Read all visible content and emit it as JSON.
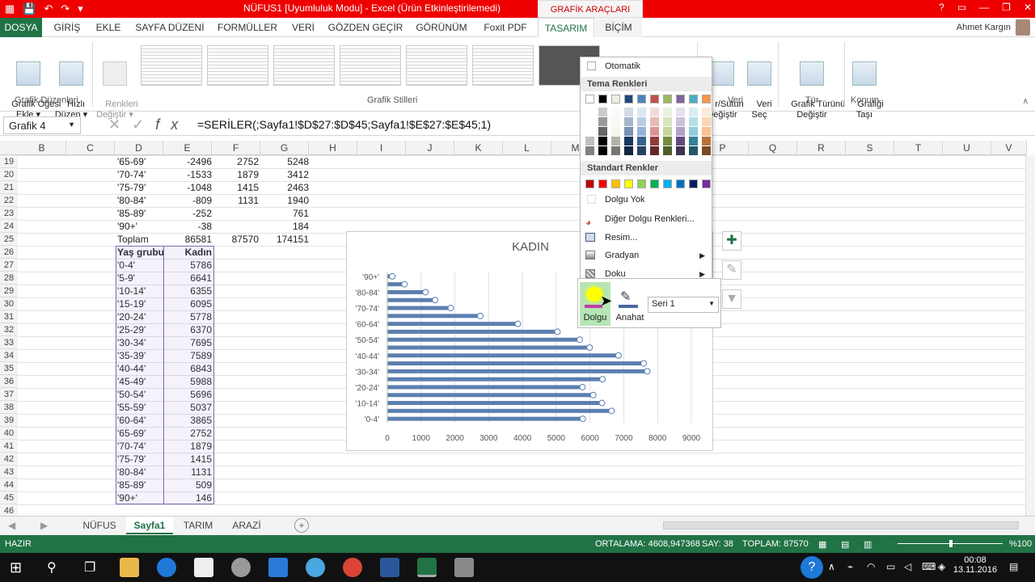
{
  "window": {
    "title": "NÜFUS1  [Uyumluluk Modu] -  Excel (Ürün Etkinleştirilemedi)",
    "tools_label": "GRAFİK ARAÇLARI",
    "user": "Ahmet Kargın",
    "controls": [
      "?",
      "▭",
      "—",
      "❐",
      "✕"
    ]
  },
  "tabs": [
    "DOSYA",
    "GİRİŞ",
    "EKLE",
    "SAYFA DÜZENİ",
    "FORMÜLLER",
    "VERİ",
    "GÖZDEN GEÇİR",
    "GÖRÜNÜM",
    "Foxit PDF",
    "TASARIM",
    "BİÇİM"
  ],
  "ribbon": {
    "add_element": "Grafik Öğesi\nEkle ▾",
    "quick_layout": "Hızlı\nDüzen ▾",
    "change_colors": "Renkleri\nDeğiştir ▾",
    "group_layouts": "Grafik Düzenleri",
    "group_styles": "Grafik Stilleri",
    "switch_rowcol": "r/Sütun\nDeğiştir",
    "select_data": "Veri\nSeç",
    "group_data": "Veri",
    "change_type": "Grafik Türünü\nDeğiştir",
    "group_type": "Tür",
    "move_chart": "Grafiği\nTaşı",
    "group_location": "Konum"
  },
  "formula_bar": {
    "name_box": "Grafik 4",
    "formula": "=SERİLER(;Sayfa1!$D$27:$D$45;Sayfa1!$E$27:$E$45;1)"
  },
  "columns": [
    "B",
    "C",
    "D",
    "E",
    "F",
    "G",
    "H",
    "I",
    "J",
    "K",
    "L",
    "M",
    "N",
    "O",
    "P",
    "Q",
    "R",
    "S",
    "T",
    "U",
    "V"
  ],
  "rows": [
    {
      "n": "19",
      "D": "'65-69'",
      "E": "-2496",
      "F": "2752",
      "G": "5248"
    },
    {
      "n": "20",
      "D": "'70-74'",
      "E": "-1533",
      "F": "1879",
      "G": "3412"
    },
    {
      "n": "21",
      "D": "'75-79'",
      "E": "-1048",
      "F": "1415",
      "G": "2463"
    },
    {
      "n": "22",
      "D": "'80-84'",
      "E": "-809",
      "F": "1131",
      "G": "1940"
    },
    {
      "n": "23",
      "D": "'85-89'",
      "E": "-252",
      "F": "",
      "G": "761"
    },
    {
      "n": "24",
      "D": "'90+'",
      "E": "-38",
      "F": "",
      "G": "184"
    },
    {
      "n": "25",
      "D": "Toplam",
      "E": "86581",
      "F": "87570",
      "G": "174151"
    },
    {
      "n": "26",
      "D": "Yaş grubu",
      "E": "Kadın",
      "F": "",
      "G": ""
    },
    {
      "n": "27",
      "D": "'0-4'",
      "E": "5786",
      "F": "",
      "G": ""
    },
    {
      "n": "28",
      "D": "'5-9'",
      "E": "6641",
      "F": "",
      "G": ""
    },
    {
      "n": "29",
      "D": "'10-14'",
      "E": "6355",
      "F": "",
      "G": ""
    },
    {
      "n": "30",
      "D": "'15-19'",
      "E": "6095",
      "F": "",
      "G": ""
    },
    {
      "n": "31",
      "D": "'20-24'",
      "E": "5778",
      "F": "",
      "G": ""
    },
    {
      "n": "32",
      "D": "'25-29'",
      "E": "6370",
      "F": "",
      "G": ""
    },
    {
      "n": "33",
      "D": "'30-34'",
      "E": "7695",
      "F": "",
      "G": ""
    },
    {
      "n": "34",
      "D": "'35-39'",
      "E": "7589",
      "F": "",
      "G": ""
    },
    {
      "n": "35",
      "D": "'40-44'",
      "E": "6843",
      "F": "",
      "G": ""
    },
    {
      "n": "36",
      "D": "'45-49'",
      "E": "5988",
      "F": "",
      "G": ""
    },
    {
      "n": "37",
      "D": "'50-54'",
      "E": "5696",
      "F": "",
      "G": ""
    },
    {
      "n": "38",
      "D": "'55-59'",
      "E": "5037",
      "F": "",
      "G": ""
    },
    {
      "n": "39",
      "D": "'60-64'",
      "E": "3865",
      "F": "",
      "G": ""
    },
    {
      "n": "40",
      "D": "'65-69'",
      "E": "2752",
      "F": "",
      "G": ""
    },
    {
      "n": "41",
      "D": "'70-74'",
      "E": "1879",
      "F": "",
      "G": ""
    },
    {
      "n": "42",
      "D": "'75-79'",
      "E": "1415",
      "F": "",
      "G": ""
    },
    {
      "n": "43",
      "D": "'80-84'",
      "E": "1131",
      "F": "",
      "G": ""
    },
    {
      "n": "44",
      "D": "'85-89'",
      "E": "509",
      "F": "",
      "G": ""
    },
    {
      "n": "45",
      "D": "'90+'",
      "E": "146",
      "F": "",
      "G": ""
    },
    {
      "n": "46",
      "D": "",
      "E": "",
      "F": "",
      "G": ""
    }
  ],
  "chart_data": {
    "type": "bar",
    "title": "KADIN",
    "categories": [
      "'0-4'",
      "'5-9'",
      "'10-14'",
      "'15-19'",
      "'20-24'",
      "'25-29'",
      "'30-34'",
      "'35-39'",
      "'40-44'",
      "'45-49'",
      "'50-54'",
      "'55-59'",
      "'60-64'",
      "'65-69'",
      "'70-74'",
      "'75-79'",
      "'80-84'",
      "'85-89'",
      "'90+'"
    ],
    "tick_labels_y": [
      "'0-4'",
      "'10-14'",
      "'20-24'",
      "'30-34'",
      "'40-44'",
      "'50-54'",
      "'60-64'",
      "'70-74'",
      "'80-84'",
      "'90+'"
    ],
    "series": [
      {
        "values": [
          5786,
          6641,
          6355,
          6095,
          5778,
          6370,
          7695,
          7589,
          6843,
          5988,
          5696,
          5037,
          3865,
          2752,
          1879,
          1415,
          1131,
          509,
          146
        ]
      }
    ],
    "xlim": [
      0,
      9000
    ],
    "xticks": [
      "0",
      "1000",
      "2000",
      "3000",
      "4000",
      "5000",
      "6000",
      "7000",
      "8000",
      "9000"
    ],
    "orientation": "horizontal",
    "bar_color": "#5b7fb0",
    "grid": true
  },
  "palette": {
    "automatic": "Otomatik",
    "theme_header": "Tema Renkleri",
    "theme_top": [
      "#ffffff",
      "#000000",
      "#eeece1",
      "#1f497d",
      "#4f81bd",
      "#c0504d",
      "#9bbb59",
      "#8064a2",
      "#4bacc6",
      "#f79646"
    ],
    "standard_header": "Standart Renkler",
    "standard": [
      "#c00000",
      "#ff0000",
      "#ffc000",
      "#ffff00",
      "#92d050",
      "#00b050",
      "#00b0f0",
      "#0070c0",
      "#002060",
      "#7030a0"
    ],
    "no_fill": "Dolgu Yok",
    "more_colors": "Diğer Dolgu Renkleri...",
    "picture": "Resim...",
    "gradient": "Gradyan",
    "texture": "Doku",
    "fill": "Dolgu",
    "outline": "Anahat",
    "series_select": "Seri 1"
  },
  "sheet_tabs": [
    "NÜFUS",
    "Sayfa1",
    "TARIM",
    "ARAZİ"
  ],
  "status": {
    "ready": "HAZIR",
    "average": "ORTALAMA: 4608,947368",
    "count": "SAY: 38",
    "sum": "TOPLAM: 87570",
    "zoom": "%100"
  },
  "clock": {
    "time": "00:08",
    "date": "13.11.2016"
  }
}
